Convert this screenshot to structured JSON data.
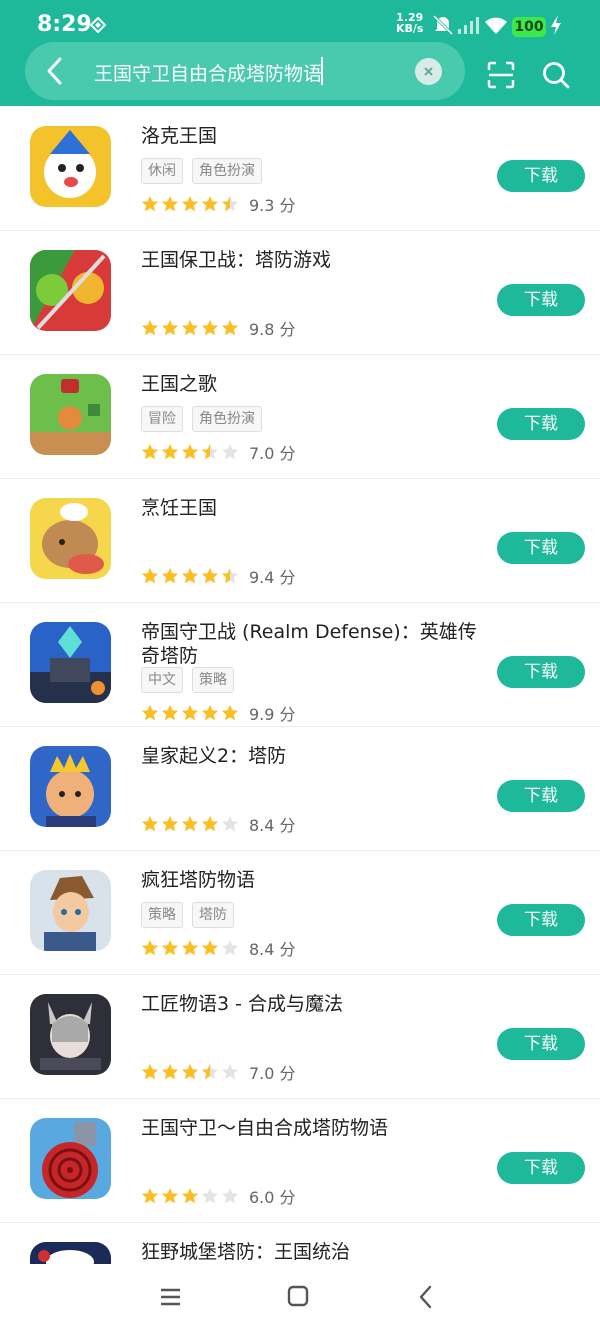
{
  "status_bar": {
    "time": "8:29",
    "net_speed": "1.29",
    "net_unit": "KB/s",
    "battery": "100"
  },
  "search": {
    "query": "王国守卫自由合成塔防物语"
  },
  "icons": {
    "back": "back-arrow-icon",
    "clear": "clear-icon",
    "scan": "scan-icon",
    "search": "search-icon"
  },
  "colors": {
    "accent": "#1db99a",
    "star": "#fbbf24",
    "star_empty": "#e3e3e3"
  },
  "download_label": "下载",
  "results": [
    {
      "title": "洛克王国",
      "tags": [
        "休闲",
        "角色扮演"
      ],
      "stars": 4.5,
      "score": "9.3 分"
    },
    {
      "title": "王国保卫战：塔防游戏",
      "tags": [],
      "stars": 5,
      "score": "9.8 分"
    },
    {
      "title": "王国之歌",
      "tags": [
        "冒险",
        "角色扮演"
      ],
      "stars": 3.5,
      "score": "7.0 分"
    },
    {
      "title": "烹饪王国",
      "tags": [],
      "stars": 4.5,
      "score": "9.4 分"
    },
    {
      "title": "帝国守卫战 (Realm Defense)：英雄传奇塔防",
      "tags": [
        "中文",
        "策略"
      ],
      "stars": 5,
      "score": "9.9 分"
    },
    {
      "title": "皇家起义2：塔防",
      "tags": [],
      "stars": 4,
      "score": "8.4 分"
    },
    {
      "title": "疯狂塔防物语",
      "tags": [
        "策略",
        "塔防"
      ],
      "stars": 4,
      "score": "8.4 分"
    },
    {
      "title": "工匠物语3 - 合成与魔法",
      "tags": [],
      "stars": 3.5,
      "score": "7.0 分"
    },
    {
      "title": "王国守卫～自由合成塔防物语",
      "tags": [],
      "stars": 3,
      "score": "6.0 分"
    },
    {
      "title": "狂野城堡塔防：王国统治",
      "tags": [],
      "stars": 0,
      "score": ""
    }
  ]
}
